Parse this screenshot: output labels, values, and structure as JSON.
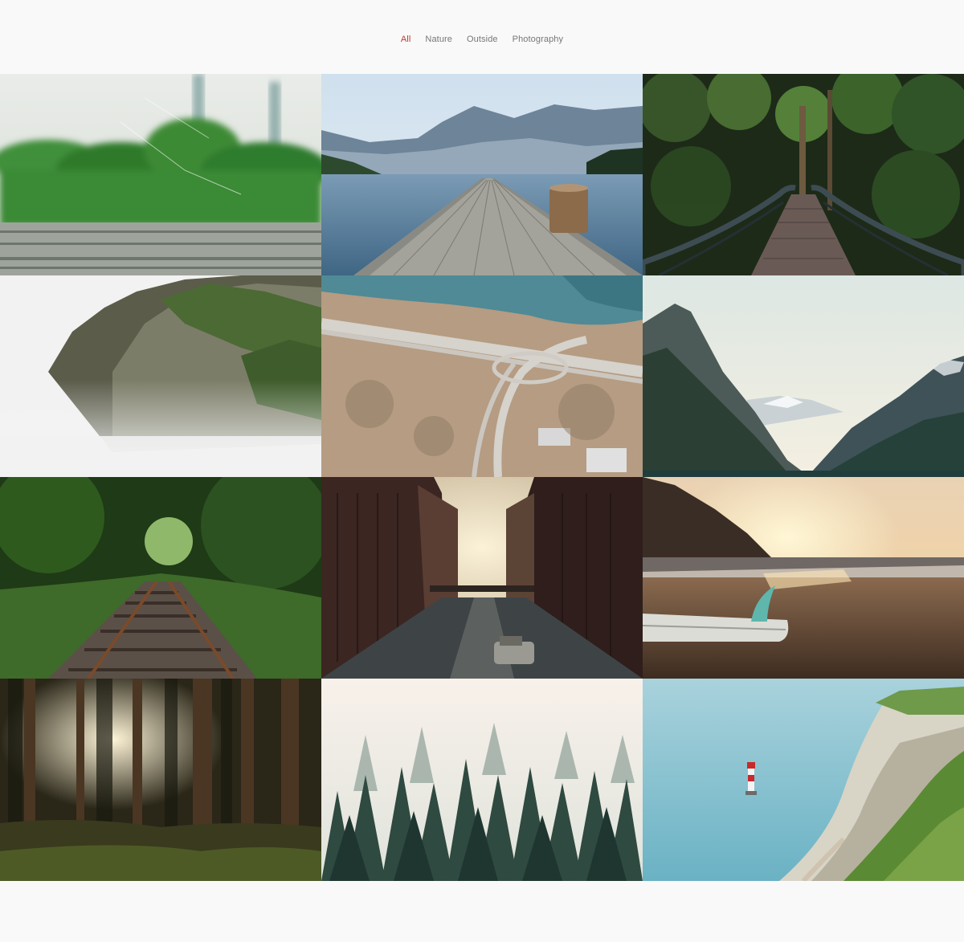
{
  "filters": {
    "items": [
      {
        "label": "All",
        "active": true
      },
      {
        "label": "Nature",
        "active": false
      },
      {
        "label": "Outside",
        "active": false
      },
      {
        "label": "Photography",
        "active": false
      }
    ]
  }
}
